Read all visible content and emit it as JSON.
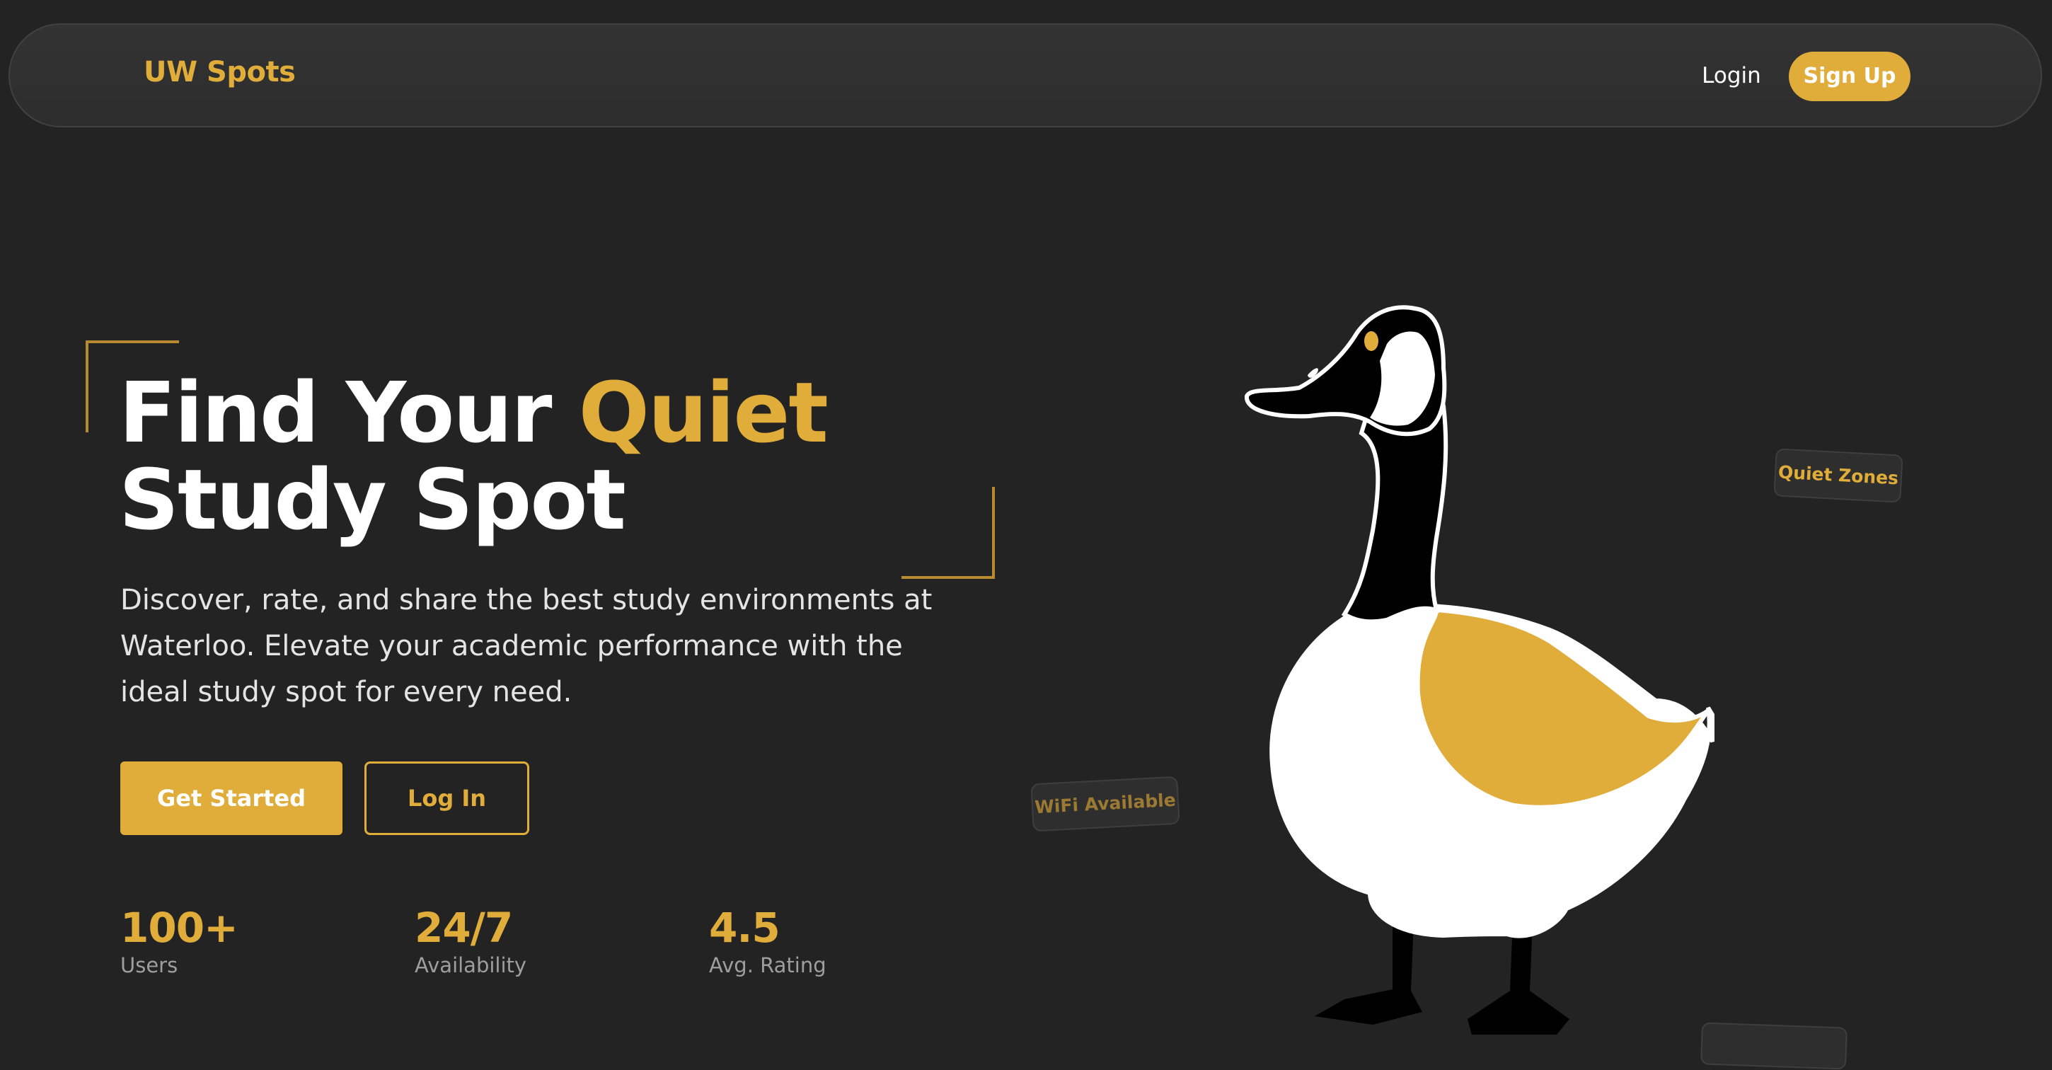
{
  "nav": {
    "brand": "UW Spots",
    "login_label": "Login",
    "signup_label": "Sign Up"
  },
  "hero": {
    "title_line1_prefix": "Find Your ",
    "title_line1_accent": "Quiet",
    "title_line2": "Study Spot",
    "description": "Discover, rate, and share the best study environments at Waterloo. Elevate your academic performance with the ideal study spot for every need.",
    "get_started_label": "Get Started",
    "login_label": "Log In"
  },
  "stats": [
    {
      "value": "100+",
      "label": "Users"
    },
    {
      "value": "24/7",
      "label": "Availability"
    },
    {
      "value": "4.5",
      "label": "Avg. Rating"
    }
  ],
  "tags": {
    "quiet": "Quiet Zones",
    "wifi": "WiFi Available"
  },
  "colors": {
    "background": "#232323",
    "accent": "#e0ac3a",
    "nav_background": "#333333"
  }
}
